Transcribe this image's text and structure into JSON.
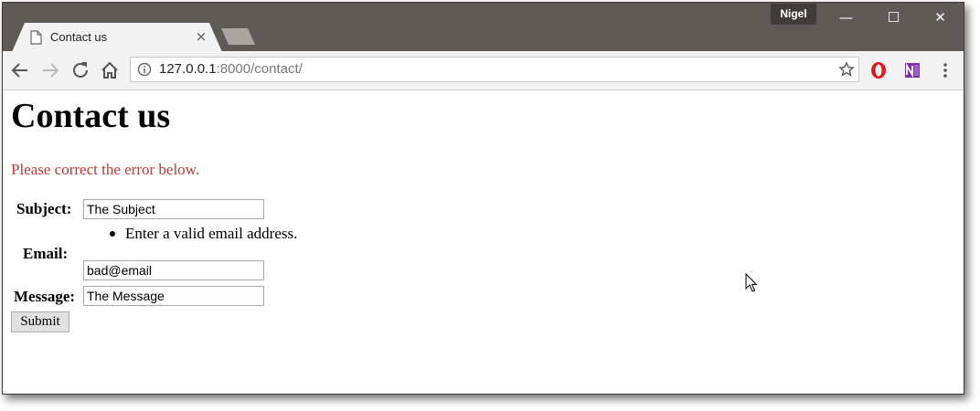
{
  "window": {
    "profile_name": "Nigel",
    "minimize_label": "—",
    "maximize_label": "☐",
    "close_label": "✕"
  },
  "tab": {
    "title": "Contact us",
    "close_label": "×"
  },
  "toolbar": {
    "url_host": "127.0.0.1",
    "url_rest": ":8000/contact/"
  },
  "page": {
    "heading": "Contact us",
    "error_summary": "Please correct the error below.",
    "form": {
      "subject_label": "Subject:",
      "subject_value": "The Subject",
      "email_error": "Enter a valid email address.",
      "email_label": "Email:",
      "email_value": "bad@email",
      "message_label": "Message:",
      "message_value": "The Message",
      "submit_label": "Submit"
    }
  },
  "colors": {
    "titlebar": "#5e5a56",
    "error_text": "#cc3333",
    "toolbar": "#f2f2f2"
  },
  "icons": [
    "page-icon",
    "back-icon",
    "forward-icon",
    "reload-icon",
    "home-icon",
    "info-icon",
    "star-icon",
    "opera-icon",
    "onenote-icon",
    "menu-icon",
    "mouse-cursor-icon"
  ]
}
